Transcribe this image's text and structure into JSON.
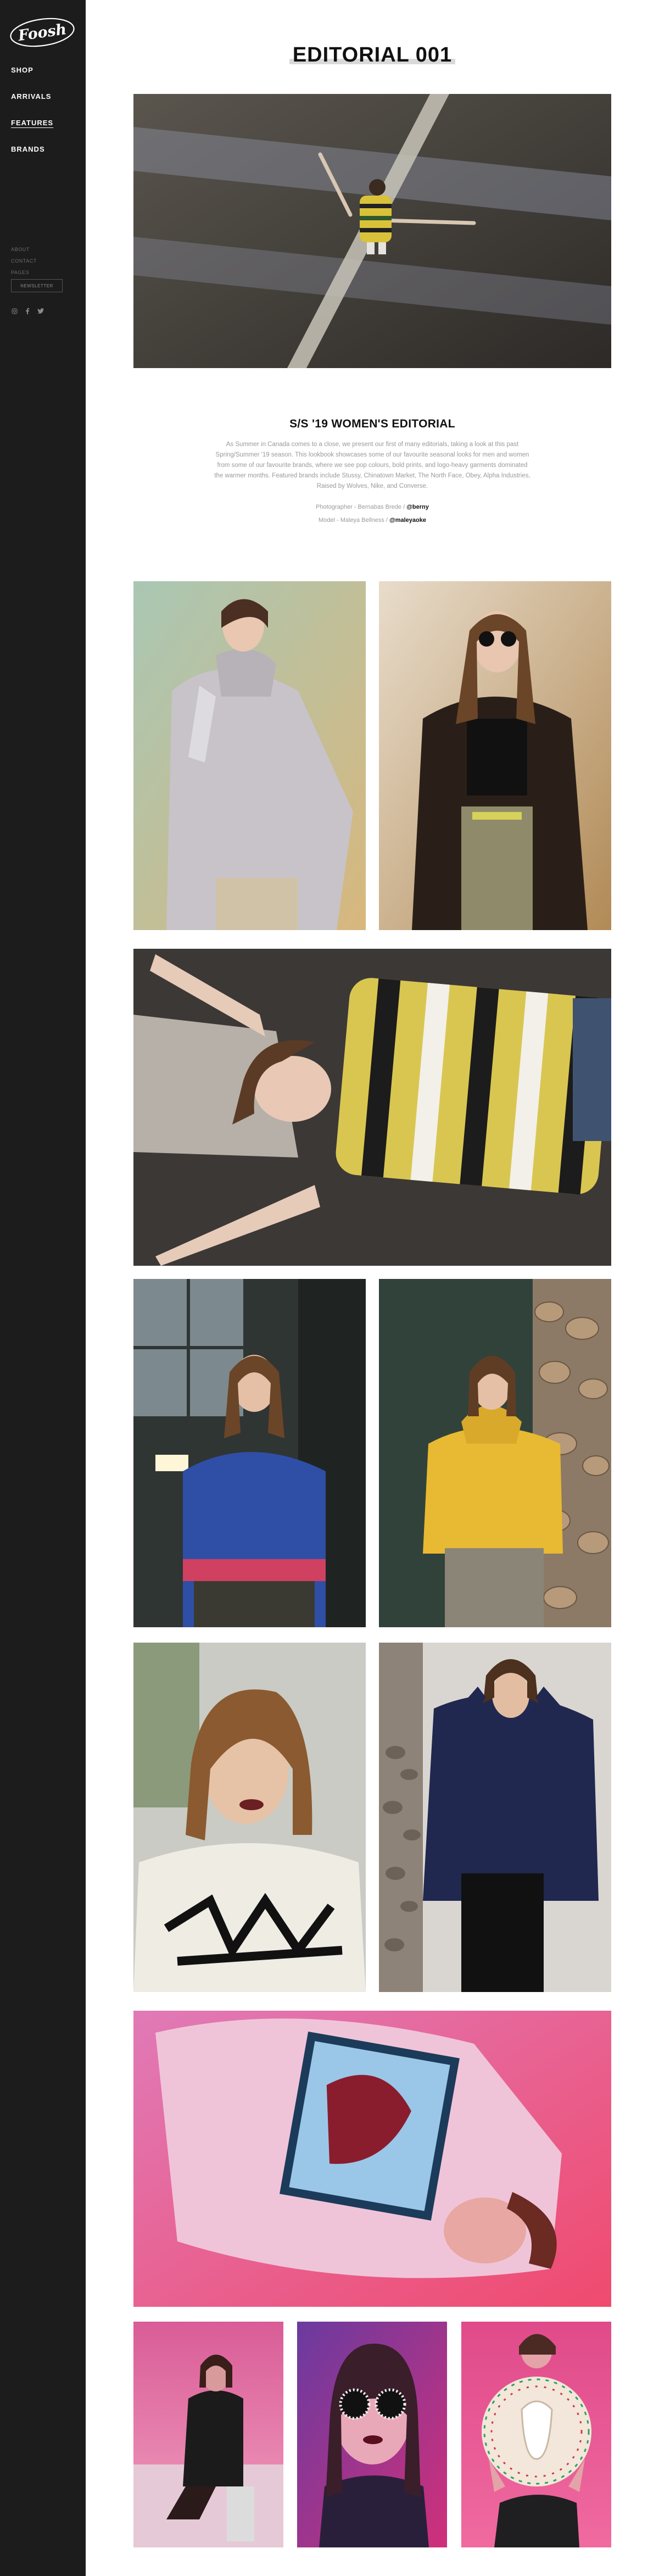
{
  "brand": {
    "logo_text": "Foosh"
  },
  "nav": {
    "items": [
      {
        "label": "SHOP"
      },
      {
        "label": "ARRIVALS"
      },
      {
        "label": "FEATURES"
      },
      {
        "label": "BRANDS"
      }
    ]
  },
  "sidebar_links": [
    "ABOUT",
    "CONTACT",
    "PAGES"
  ],
  "newsletter_label": "NEWSLETTER",
  "page": {
    "title": "EDITORIAL 001"
  },
  "article": {
    "heading": "S/S '19 WOMEN'S EDITORIAL",
    "body": "As Summer in Canada comes to a close, we present our first of many editorials, taking a look at this past Spring/Summer '19 season. This lookbook showcases some of our favourite seasonal looks for men and women from some of our favourite brands, where we see pop colours, bold prints, and logo-heavy garments dominated the warmer months. Featured brands include Stussy, Chinatown Market, The North Face, Obey, Alpha Industries, Raised by Wolves, Nike, and Converse.",
    "photographer_label": "Photographer - Bernabas Brede /",
    "photographer_handle": "@berny",
    "model_label": "Model - Maleya Bellness /",
    "model_handle": "@maleyaoke"
  },
  "colors": {
    "sidebar_bg": "#1c1c1c",
    "text_dark": "#111111",
    "text_muted": "#9a9a9a"
  }
}
